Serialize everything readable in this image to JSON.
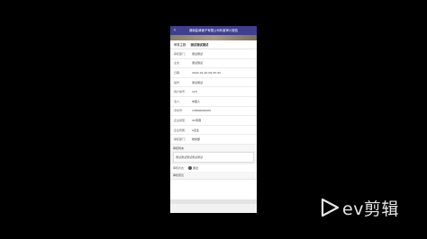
{
  "app": {
    "title": "湖南盐津铺子有限公司年度审计报告",
    "back_icon": "chevron-left-icon"
  },
  "header": {
    "label": "审核主题：",
    "value": "测试测试测试"
  },
  "fields": [
    {
      "key": "审核部门：",
      "value": "测试测试"
    },
    {
      "key": "业务：",
      "value": "测试测试"
    },
    {
      "key": "日期：",
      "value": "2022-01-20 09:25:43"
    },
    {
      "key": "编号：",
      "value": "测试测试"
    },
    {
      "key": "用户编号：",
      "value": "123"
    },
    {
      "key": "法人：",
      "value": "中国人"
    },
    {
      "key": "手机号：",
      "value": "13800000000"
    },
    {
      "key": "企业类型：",
      "value": "XX有限"
    },
    {
      "key": "企业所属：",
      "value": "A企业"
    },
    {
      "key": "审核部门：",
      "value": "财务部"
    }
  ],
  "remark": {
    "label": "审核附言",
    "text": "测试测试测试测试测试"
  },
  "check": {
    "label": "审核状态：",
    "value": "通过"
  },
  "opinion": {
    "label": "审核意见"
  },
  "watermark": {
    "text": "ev剪辑"
  },
  "colors": {
    "titlebar": "#3f3f8f",
    "background": "#000000"
  }
}
